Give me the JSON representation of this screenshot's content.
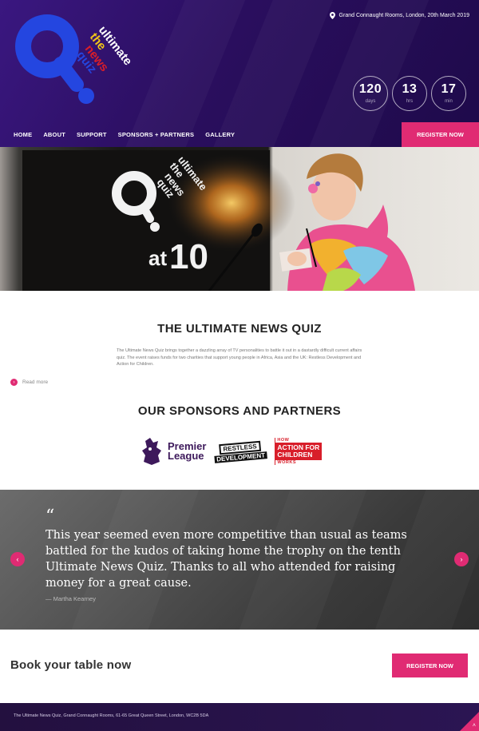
{
  "header": {
    "logo_words": [
      "the",
      "ultimate",
      "news",
      "quiz"
    ],
    "location": "Grand Connaught Rooms, London, 20th March 2019",
    "countdown": [
      {
        "value": "120",
        "unit": "days"
      },
      {
        "value": "13",
        "unit": "hrs"
      },
      {
        "value": "17",
        "unit": "min"
      }
    ]
  },
  "nav": {
    "items": [
      "HOME",
      "ABOUT",
      "SUPPORT",
      "SPONSORS + PARTNERS",
      "GALLERY"
    ],
    "register_label": "REGISTER NOW"
  },
  "hero": {
    "sign_words": [
      "the",
      "ultimate",
      "news",
      "quiz",
      "at",
      "10"
    ]
  },
  "intro": {
    "title": "THE ULTIMATE NEWS QUIZ",
    "text": "The Ultimate News Quiz brings together a dazzling array of TV personalities to battle it out in a dastardly difficult current affairs quiz. The event raises funds for two charities that support young people in Africa, Asia and the UK: Restless Development and Action for Children.",
    "read_more": "Read more"
  },
  "sponsors": {
    "title": "OUR SPONSORS AND PARTNERS",
    "premier_league": [
      "Premier",
      "League"
    ],
    "restless": [
      "RESTLESS",
      "DEVELOPMENT"
    ],
    "action_for_children": {
      "top": "HOW",
      "box": [
        "ACTION FOR",
        "CHILDREN"
      ],
      "bottom": "WORKS"
    }
  },
  "testimonial": {
    "quote_mark": "“",
    "quote": "This year seemed even more competitive than usual as teams battled for the kudos of taking home the trophy on the tenth Ultimate News Quiz. Thanks to all who attended for raising money for a great cause.",
    "author": "— Martha Kearney",
    "prev_icon": "chevron-left-icon",
    "next_icon": "chevron-right-icon"
  },
  "book": {
    "title": "Book your table now",
    "register_label": "REGISTER NOW"
  },
  "footer": {
    "text": "The Ultimate News Quiz, Grand Connaught Rooms, 61-65 Great Queen Street, London, WC2B 5DA"
  },
  "colors": {
    "accent": "#e02b73",
    "logo_blue": "#2446e0",
    "header_purple": "#2a0e5e",
    "logo_yellow": "#f0c419",
    "logo_red": "#d81e2a"
  }
}
